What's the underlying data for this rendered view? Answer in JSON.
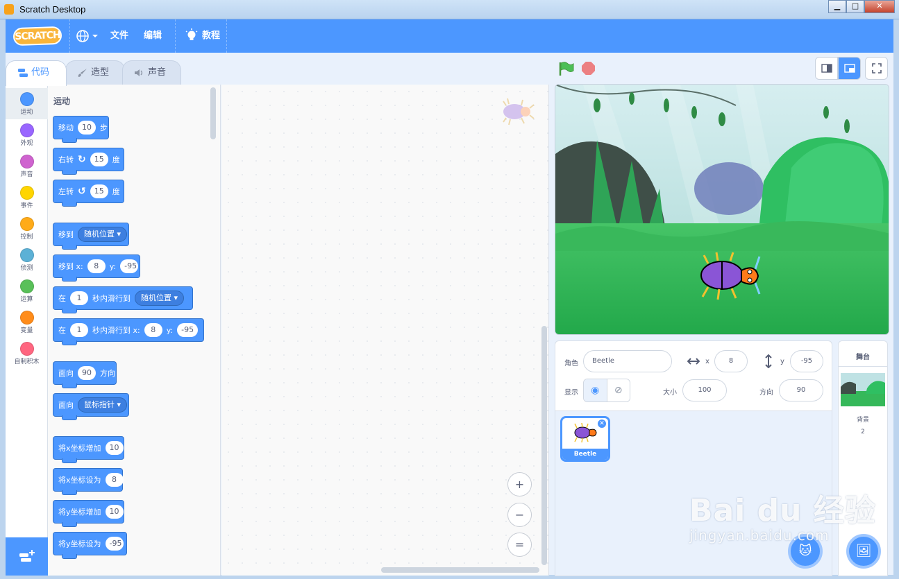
{
  "window": {
    "title": "Scratch Desktop",
    "minimize": "▁",
    "maximize": "□",
    "close": "✕"
  },
  "menubar": {
    "logo": "SCRATCH",
    "language_icon": "globe-icon",
    "file": "文件",
    "edit": "编辑",
    "tutorials": "教程"
  },
  "tabs": [
    {
      "label": "代码"
    },
    {
      "label": "造型"
    },
    {
      "label": "声音"
    }
  ],
  "categories": [
    {
      "label": "运动",
      "color": "#4c97ff"
    },
    {
      "label": "外观",
      "color": "#9966ff"
    },
    {
      "label": "声音",
      "color": "#cf63cf"
    },
    {
      "label": "事件",
      "color": "#ffd500"
    },
    {
      "label": "控制",
      "color": "#ffab19"
    },
    {
      "label": "侦测",
      "color": "#5cb1d6"
    },
    {
      "label": "运算",
      "color": "#59c059"
    },
    {
      "label": "变量",
      "color": "#ff8c1a"
    },
    {
      "label": "自制积木",
      "color": "#ff6680"
    }
  ],
  "flyout": {
    "heading": "运动",
    "move": {
      "label": "移动",
      "steps": "10",
      "unit": "步"
    },
    "turn_right": {
      "label": "右转",
      "degrees": "15",
      "unit": "度"
    },
    "turn_left": {
      "label": "左转",
      "degrees": "15",
      "unit": "度"
    },
    "goto": {
      "label": "移到",
      "target": "随机位置"
    },
    "goto_xy": {
      "label": "移到 x:",
      "x": "8",
      "ylabel": "y:",
      "y": "-95"
    },
    "glide": {
      "label": "在",
      "secs": "1",
      "mid": "秒内滑行到",
      "target": "随机位置"
    },
    "glide_xy": {
      "label": "在",
      "secs": "1",
      "mid": "秒内滑行到 x:",
      "x": "8",
      "ylabel": "y:",
      "y": "-95"
    },
    "point_dir": {
      "label": "面向",
      "dir": "90",
      "unit": "方向"
    },
    "point_towards": {
      "label": "面向",
      "target": "鼠标指针"
    },
    "change_x": {
      "label": "将x坐标增加",
      "val": "10"
    },
    "set_x": {
      "label": "将x坐标设为",
      "val": "8"
    },
    "change_y": {
      "label": "将y坐标增加",
      "val": "10"
    },
    "set_y": {
      "label": "将y坐标设为",
      "val": "-95"
    }
  },
  "zoom": {
    "in": "+",
    "out": "−",
    "reset": "="
  },
  "sprite_info": {
    "sprite_label": "角色",
    "sprite_name": "Beetle",
    "x_label": "x",
    "x": "8",
    "y_label": "y",
    "y": "-95",
    "show_label": "显示",
    "size_label": "大小",
    "size": "100",
    "direction_label": "方向",
    "direction": "90"
  },
  "sprites": [
    {
      "name": "Beetle"
    }
  ],
  "stage_pane": {
    "title": "舞台",
    "backdrops_label": "背景",
    "backdrops_count": "2"
  },
  "watermark": {
    "line1": "Bai du 经验",
    "line2": "jingyan.baidu.com"
  }
}
